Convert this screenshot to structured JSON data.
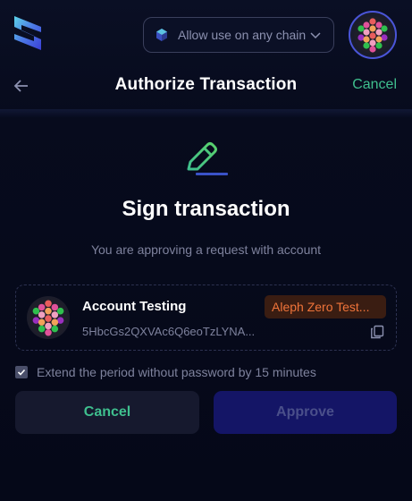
{
  "chain_selector": {
    "label": "Allow use on any chain"
  },
  "header": {
    "title": "Authorize Transaction",
    "cancel_label": "Cancel"
  },
  "main": {
    "title": "Sign transaction",
    "subtitle": "You are approving a request with account"
  },
  "account": {
    "name": "Account Testing",
    "address": "5HbcGs2QXVAc6Q6eoTzLYNA...",
    "network": "Aleph Zero Test..."
  },
  "extend_option": {
    "label": "Extend the period without password by 15 minutes",
    "checked": true
  },
  "actions": {
    "cancel_label": "Cancel",
    "approve_label": "Approve"
  },
  "colors": {
    "accent_green": "#3fbf8e",
    "network_badge_text": "#f0743a",
    "approve_bg": "#141566",
    "avatar_ring": "#4a55d8"
  }
}
